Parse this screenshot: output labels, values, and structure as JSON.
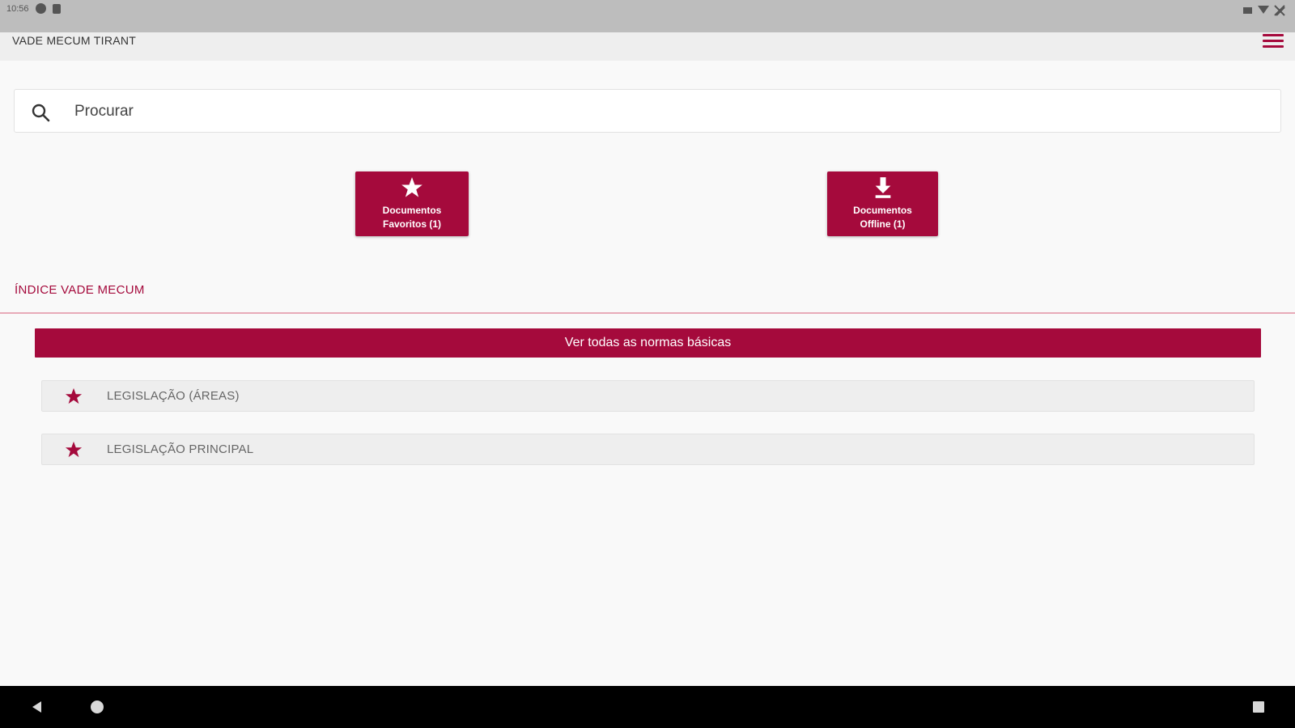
{
  "status_bar": {
    "time": "10:56"
  },
  "app_bar": {
    "title": "VADE MECUM TIRANT",
    "menu_icon": "hamburger-menu-icon"
  },
  "search": {
    "placeholder": "Procurar",
    "icon": "search-icon"
  },
  "quick_buttons": [
    {
      "icon": "star-icon",
      "label_line1": "Documentos",
      "label_line2": "Favoritos (1)"
    },
    {
      "icon": "download-icon",
      "label_line1": "Documentos",
      "label_line2": "Offline (1)"
    }
  ],
  "index_section": {
    "title": "ÍNDICE VADE MECUM",
    "view_all_label": "Ver todas as normas básicas",
    "items": [
      {
        "icon": "star-icon",
        "label": "LEGISLAÇÃO (ÁREAS)"
      },
      {
        "icon": "star-icon",
        "label": "LEGISLAÇÃO PRINCIPAL"
      }
    ]
  },
  "nav_bar": {
    "back_icon": "back-triangle-icon",
    "home_icon": "home-circle-icon",
    "recents_icon": "recents-square-icon"
  },
  "colors": {
    "accent": "#a50a3c",
    "background": "#f9f9f9",
    "app_bar": "#eeeeee",
    "status_bar": "#bdbdbd",
    "nav_bar": "#000000"
  }
}
